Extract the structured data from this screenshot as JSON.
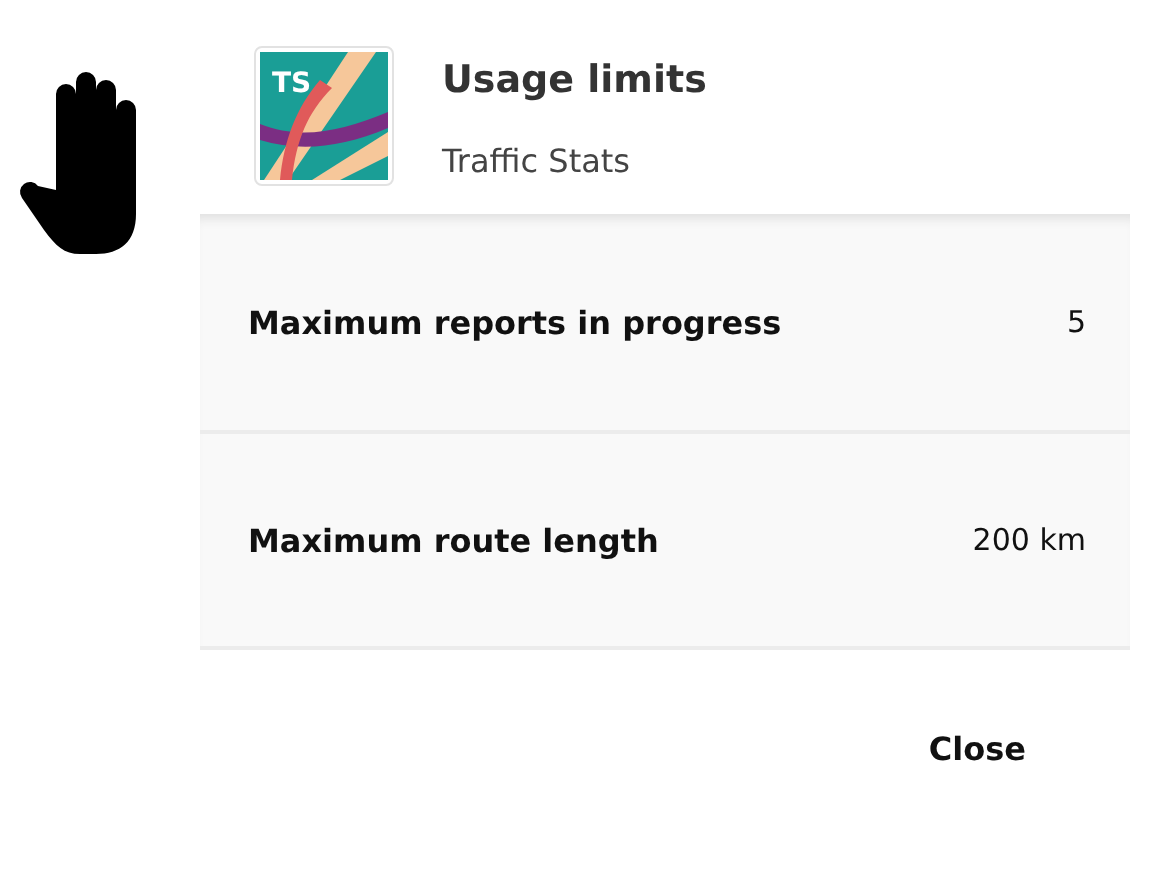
{
  "app": {
    "logo_text": "TS",
    "title": "Usage limits",
    "subtitle": "Traffic Stats"
  },
  "limits": [
    {
      "label": "Maximum reports in progress",
      "value": "5"
    },
    {
      "label": "Maximum route length",
      "value": "200 km"
    }
  ],
  "buttons": [
    "Close"
  ]
}
